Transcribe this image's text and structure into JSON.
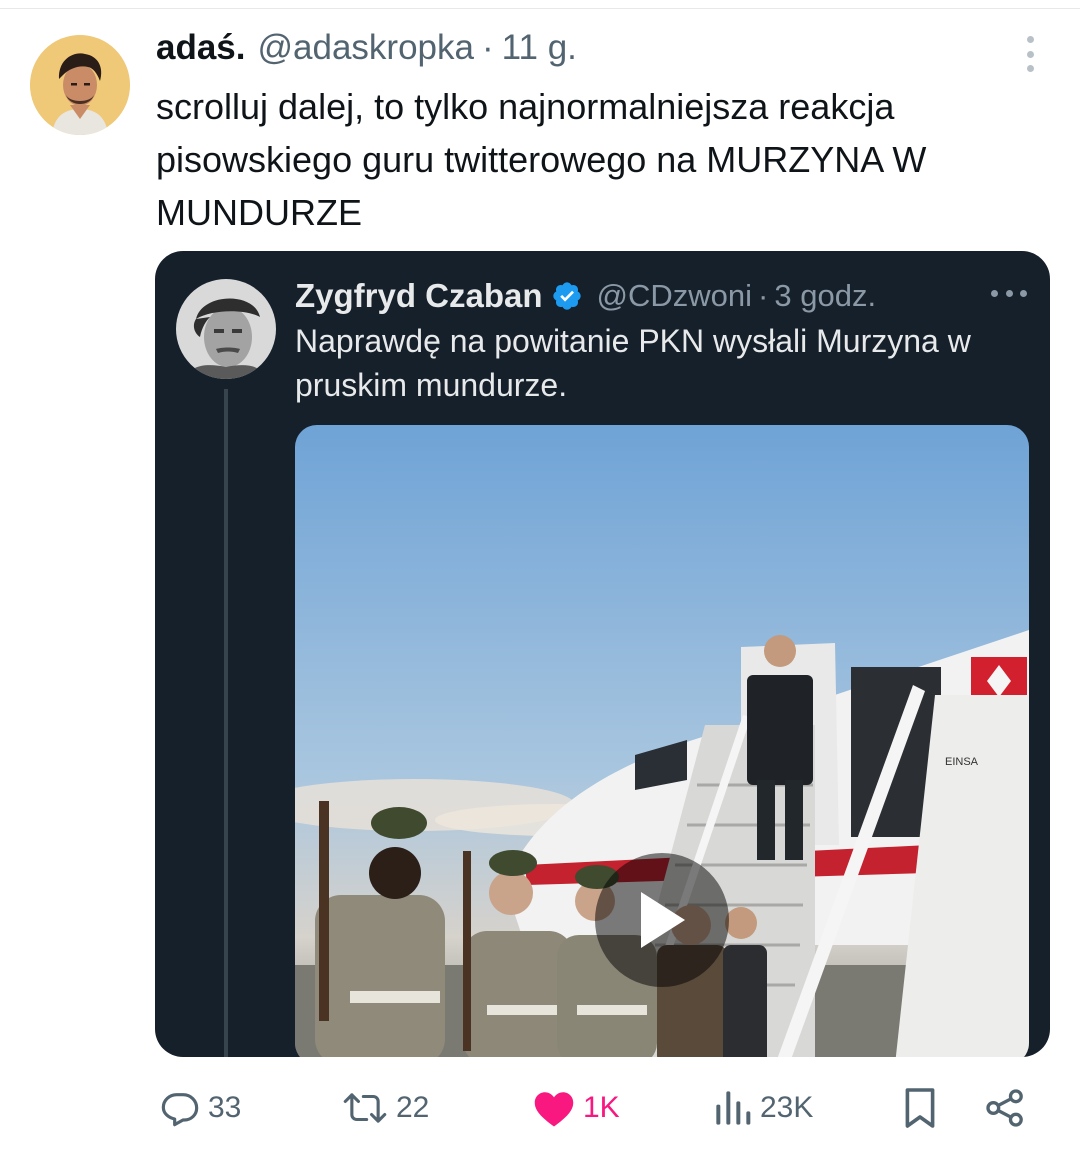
{
  "tweet": {
    "display_name": "adaś.",
    "handle": "@adaskropka",
    "separator": "·",
    "time": "11 g.",
    "text": "scrolluj dalej, to tylko najnormalniejsza reakcja pisowskiego guru twitterowego na MURZYNA W MUNDURZE",
    "more_icon": "vertical-ellipsis-icon"
  },
  "quoted_tweet": {
    "display_name": "Zygfryd Czaban",
    "verified_icon": "verified-badge-icon",
    "handle": "@CDzwoni",
    "separator": "·",
    "time": "3 godz.",
    "text": "Naprawdę na powitanie PKN wysłali Murzyna w pruskim mundurze.",
    "more_icon": "horizontal-ellipsis-icon",
    "media": {
      "type": "video",
      "play_icon": "play-icon",
      "stair_sign_text": "EINSA"
    }
  },
  "actions": {
    "replies": {
      "icon": "reply-icon",
      "count": "33"
    },
    "retweets": {
      "icon": "retweet-icon",
      "count": "22"
    },
    "likes": {
      "icon": "heart-icon",
      "count": "1K",
      "active": true,
      "color": "#f91880"
    },
    "views": {
      "icon": "views-chart-icon",
      "count": "23K"
    },
    "bookmark": {
      "icon": "bookmark-icon"
    },
    "share": {
      "icon": "share-icon"
    }
  },
  "colors": {
    "text_primary": "#0f1419",
    "text_secondary": "#536471",
    "quote_background": "#15202b",
    "quote_text": "#e7e9ea",
    "quote_muted": "#8b98a5",
    "verified_blue": "#1d9bf0",
    "like_pink": "#f91880"
  }
}
